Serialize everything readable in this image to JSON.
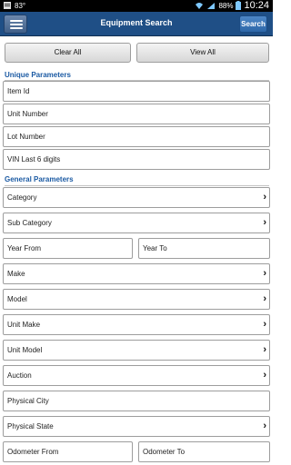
{
  "status_bar": {
    "signal_text": "83°",
    "battery_pct": "88%",
    "time": "10:24"
  },
  "header": {
    "title": "Equipment Search",
    "search_label": "Search"
  },
  "buttons": {
    "clear_all": "Clear All",
    "view_all": "View All"
  },
  "unique_parameters": {
    "heading": "Unique Parameters",
    "fields": [
      "Item Id",
      "Unit Number",
      "Lot Number",
      "VIN Last 6 digits"
    ]
  },
  "general_parameters": {
    "heading": "General Parameters",
    "category": "Category",
    "sub_category": "Sub Category",
    "year_from": "Year From",
    "year_to": "Year To",
    "make": "Make",
    "model": "Model",
    "unit_make": "Unit Make",
    "unit_model": "Unit Model",
    "auction": "Auction",
    "physical_city": "Physical City",
    "physical_state": "Physical State",
    "odometer_from": "Odometer  From",
    "odometer_to": "Odometer To"
  },
  "icons": {
    "chevron": "chevron-right-icon",
    "menu": "hamburger-menu-icon"
  }
}
